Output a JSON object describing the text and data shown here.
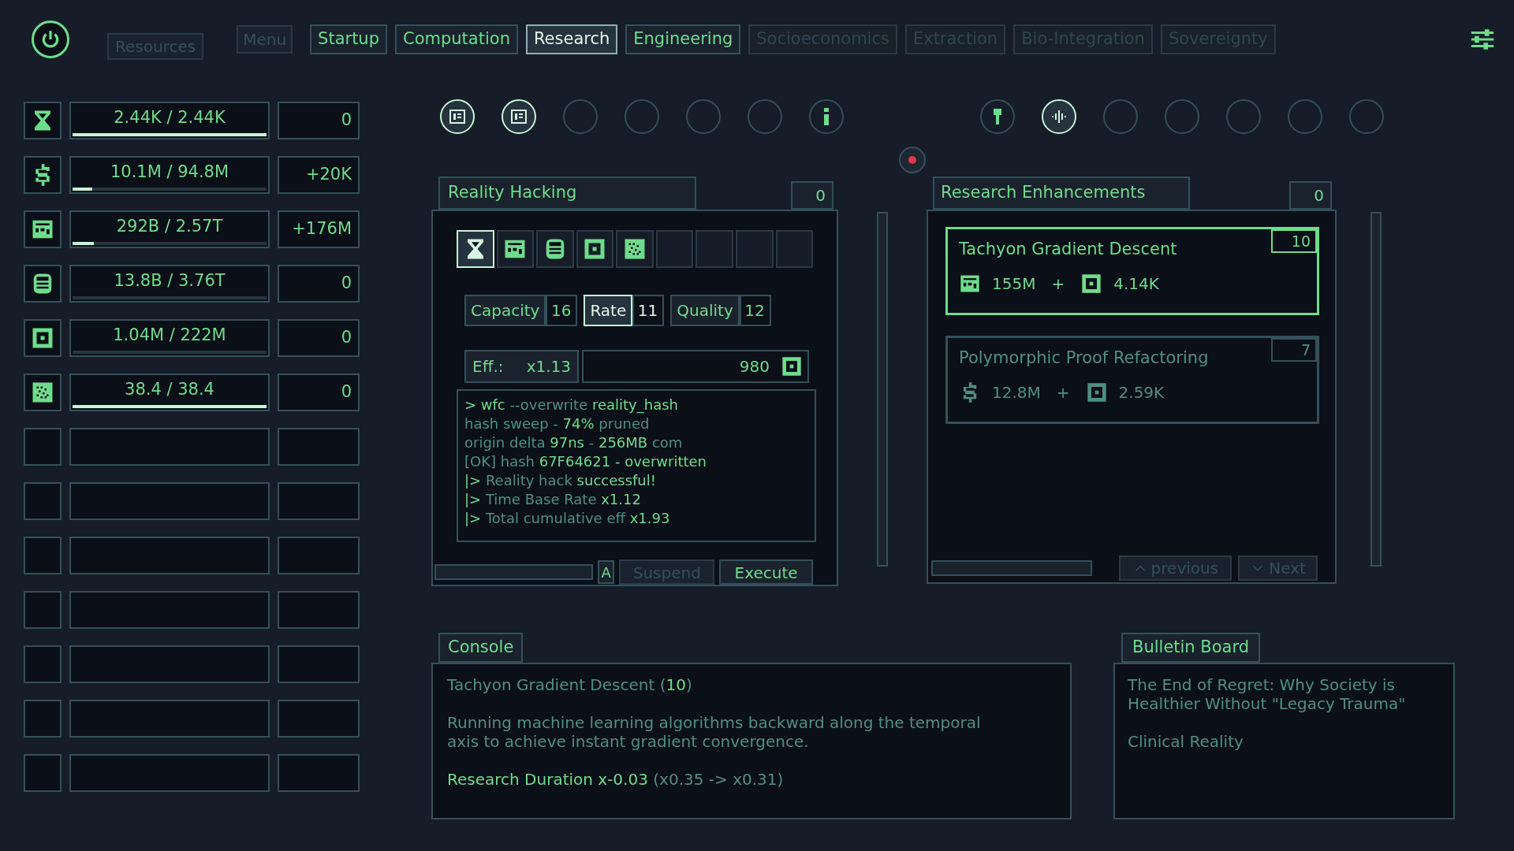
{
  "header": {
    "resources_button": {
      "label": "Resources",
      "disabled": true
    },
    "menu_button": {
      "label": "Menu",
      "disabled": true
    },
    "tabs": [
      {
        "label": "Startup",
        "selected": false,
        "disabled": false
      },
      {
        "label": "Computation",
        "selected": false,
        "disabled": false
      },
      {
        "label": "Research",
        "selected": true,
        "disabled": false
      },
      {
        "label": "Engineering",
        "selected": false,
        "disabled": false
      },
      {
        "label": "Socioeconomics",
        "selected": false,
        "disabled": true
      },
      {
        "label": "Extraction",
        "selected": false,
        "disabled": true
      },
      {
        "label": "Bio-Integration",
        "selected": false,
        "disabled": true
      },
      {
        "label": "Sovereignty",
        "selected": false,
        "disabled": true
      }
    ]
  },
  "resources": [
    {
      "kind": "filled",
      "value": "2.44K / 2.44K",
      "rate": "0",
      "level": 1
    },
    {
      "kind": "filled",
      "value": "10.1M / 94.8M",
      "rate": "+20K",
      "level": 0.1
    },
    {
      "kind": "filled",
      "value": "292B / 2.57T",
      "rate": "+176M",
      "level": 0.11
    },
    {
      "kind": "filled",
      "value": "13.8B / 3.76T",
      "rate": "0"
    },
    {
      "kind": "filled",
      "value": "1.04M / 222M",
      "rate": "0"
    },
    {
      "kind": "filled",
      "value": "38.4 / 38.4",
      "rate": "0",
      "level": 1
    },
    {
      "kind": "empty"
    },
    {
      "kind": "empty"
    },
    {
      "kind": "empty"
    },
    {
      "kind": "empty"
    },
    {
      "kind": "empty"
    },
    {
      "kind": "empty"
    },
    {
      "kind": "empty"
    }
  ],
  "nodes": [
    {
      "active": true
    },
    {
      "active": true
    },
    {
      "active": false
    },
    {
      "active": false
    },
    {
      "active": false
    },
    {
      "active": false
    },
    {
      "active": false
    },
    {
      "active": false
    },
    {
      "active": true
    },
    {
      "active": false
    },
    {
      "active": false
    },
    {
      "active": false
    },
    {
      "active": false
    },
    {
      "active": false
    }
  ],
  "reality_hacking": {
    "title": "Reality Hacking",
    "count": "0",
    "slots": [
      {
        "kind": "filled",
        "selected": true
      },
      {
        "kind": "filled",
        "selected": false
      },
      {
        "kind": "filled",
        "selected": false
      },
      {
        "kind": "filled",
        "selected": false
      },
      {
        "kind": "filled",
        "selected": false
      },
      {
        "kind": "empty",
        "selected": false
      },
      {
        "kind": "empty",
        "selected": false
      },
      {
        "kind": "empty",
        "selected": false
      },
      {
        "kind": "empty",
        "selected": false
      }
    ],
    "stats": [
      {
        "label": "Capacity",
        "value": "16",
        "selected": false
      },
      {
        "label": "Rate",
        "value": "11",
        "selected": true
      },
      {
        "label": "Quality",
        "value": "12",
        "selected": false
      }
    ],
    "efficiency": {
      "label": "Eff.:",
      "value": "x1.13"
    },
    "amount": {
      "value": "980"
    },
    "log": [
      [
        {
          "text": "> wfc ",
          "bright": true
        },
        {
          "text": "--overwrite ",
          "bright": false
        },
        {
          "text": "reality_hash",
          "bright": true
        }
      ],
      [
        {
          "text": "hash sweep - ",
          "bright": false
        },
        {
          "text": "74%",
          "bright": true
        },
        {
          "text": " pruned",
          "bright": false
        }
      ],
      [
        {
          "text": "origin delta ",
          "bright": false
        },
        {
          "text": "97ns",
          "bright": true
        },
        {
          "text": " - ",
          "bright": false
        },
        {
          "text": "256MB",
          "bright": true
        },
        {
          "text": " com",
          "bright": false
        }
      ],
      [
        {
          "text": "[OK] hash ",
          "bright": false
        },
        {
          "text": "67F64621 - overwritten",
          "bright": true
        }
      ],
      [
        {
          "text": "|> ",
          "bright": true
        },
        {
          "text": "Reality hack ",
          "bright": false
        },
        {
          "text": "successful!",
          "bright": true
        }
      ],
      [
        {
          "text": "|> ",
          "bright": true
        },
        {
          "text": "Time Base Rate ",
          "bright": false
        },
        {
          "text": "x1.12",
          "bright": true
        }
      ],
      [
        {
          "text": "|> ",
          "bright": true
        },
        {
          "text": "Total cumulative eff ",
          "bright": false
        },
        {
          "text": "x1.93",
          "bright": true
        }
      ]
    ],
    "auto_button": {
      "label": "A"
    },
    "suspend_button": {
      "label": "Suspend",
      "disabled": true
    },
    "execute_button": {
      "label": "Execute",
      "disabled": false
    }
  },
  "research": {
    "title": "Research Enhancements",
    "count": "0",
    "items": [
      {
        "name": "Tachyon Gradient Descent",
        "level": "10",
        "selected": true,
        "separator": "+",
        "costs": [
          {
            "amount": "155M"
          },
          {
            "amount": "4.14K"
          }
        ]
      },
      {
        "name": "Polymorphic Proof Refactoring",
        "level": "7",
        "selected": false,
        "separator": "+",
        "costs": [
          {
            "amount": "12.8M"
          },
          {
            "amount": "2.59K"
          }
        ]
      }
    ],
    "previous_button": {
      "label": "previous",
      "disabled": true
    },
    "next_button": {
      "label": "Next",
      "disabled": true
    }
  },
  "console": {
    "title": "Console",
    "heading": [
      {
        "text": "Tachyon Gradient Descent (",
        "bright": false
      },
      {
        "text": "10",
        "bright": true
      },
      {
        "text": ")",
        "bright": false
      }
    ],
    "description": "Running machine learning algorithms backward along the temporal axis to achieve instant gradient convergence.",
    "effect": [
      {
        "text": "Research Duration x-0.03 ",
        "bright": true
      },
      {
        "text": "(x0.35 -> x0.31)",
        "bright": false
      }
    ]
  },
  "bulletin": {
    "title": "Bulletin Board",
    "headline": "The End of Regret: Why Society is Healthier Without \"Legacy Trauma\"",
    "source": "Clinical Reality"
  }
}
